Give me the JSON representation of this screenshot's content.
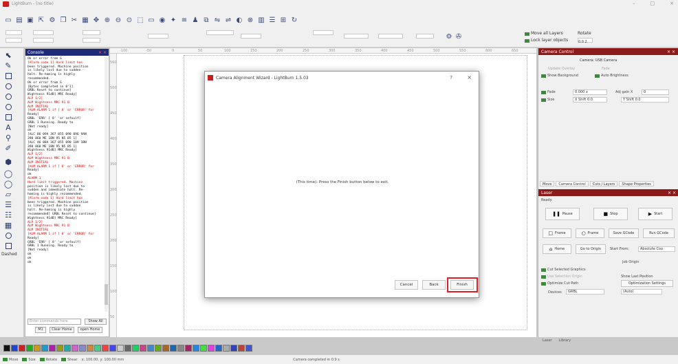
{
  "window": {
    "title": "LightBurn - (no title)"
  },
  "canvas_numbers": [
    "-100",
    "-50",
    "0",
    "50",
    "100",
    "150",
    "200",
    "250",
    "300",
    "350",
    "400",
    "450",
    "500",
    "550",
    "600",
    "650"
  ],
  "canvas_left_numbers": [
    "560",
    "500",
    "450",
    "400",
    "350",
    "300",
    "250",
    "200",
    "150",
    "100",
    "50"
  ],
  "console": {
    "title": "Console",
    "lines": [
      "Ok or error from G",
      "[Alarm code 1] Hard limit has",
      "been triggered. Machine position",
      "is likely lost due to sudden",
      "halt. Re-homing is highly",
      "recommended.",
      "Ok or error from G",
      "[Bytes completed in 0'1]",
      "GRBL Reset to continue]",
      "Wightness 91dB] MRC Ready]",
      "ALP 1/2]",
      "ALM Wightness MRC 91 B",
      "ALM INITIAL",
      "[ALM ALARM 1 if [ 8' or 'ERROR' for",
      "Ready]",
      "GRBL 'ERR' [ 8' 'or sefoulf]",
      "GRBL 1 Running. Ready to",
      "[Not ready]",
      "ok",
      "[ALC 86 09A 367 055 090 096 9AN",
      "390 860 ME 1BN 95 N5 B5 1]",
      "[ALC 46 88A 367 055 090 109 1BN",
      "390 860 ME 1BN 95 N5 B5 1]",
      "Wightness 91dB] MRC Ready]",
      "ALP 1/2]",
      "ALM Wightness MRC 91 B",
      "ALM INITIAL",
      "[ALM ALARM 1 if [ 8' or 'ERROR' for",
      "Ready]",
      "ok",
      "ALARM 1",
      "Hard limit triggered. Machine",
      "position is likely lost due to",
      "sudden and immediate halt. Re-",
      "homing is highly recommended.",
      "[Alarm code 1] Hard limit has",
      "been triggered. Machine position",
      "is likely lost due to sudden",
      "halt. Re-homing is highly",
      "recommended] GRBL Reset to continue]",
      "Wightness 91dB] MRC Ready]",
      "ALP 1/2]",
      "ALM Wightness MRC 91 B",
      "ALM INITIAL",
      "[ALM ALARM 1 if [ 8' or 'ERROR' for",
      "Ready]",
      "GRBL 'ERR' [ 8' 'or sefoulf]",
      "GRBL 1 Running. Ready to",
      "[Not ready]",
      "ok",
      "ok",
      "ok"
    ],
    "input_placeholder": "Enter commands here",
    "show_all_label": "Show All",
    "btn_macro": "M1",
    "btn_clear": "Clear Home",
    "btn_open": "open Home",
    "btn_m3": "M3",
    "btn_m4": "M4",
    "btn_m5": "M5"
  },
  "left_tools": {
    "dashed_label": "Dashed"
  },
  "dialog": {
    "title": "Camera Alignment Wizard - LightBurn 1.5.03",
    "help": "?",
    "close": "×",
    "message": "(This time): Press the Finish button below to exit.",
    "cancel_label": "Cancel",
    "back_label": "Back",
    "finish_label": "Finish"
  },
  "right_panel": {
    "camera_title": "Camera Control",
    "camera_name": "Camera: USB Camera",
    "update_overlay": "Update Overlay",
    "fade": "Fade",
    "show_background": "Show Background",
    "auto_brightness": "Auto Brightness",
    "fade_label": "Fade",
    "fade_value": "0.000 x",
    "adjust_x": "Adj gain X",
    "adjust_x_value": "0",
    "size_label": "Size",
    "size_value": "X Shift 0.0",
    "size_y_value": "Y Shift 0.0",
    "tabs": [
      "Move",
      "Camera Control",
      "Cuts / Layers",
      "Shape Properties"
    ],
    "laser_title": "Laser",
    "ready": "Ready",
    "pause_label": "Pause",
    "stop_label": "Stop",
    "start_label": "Start",
    "frame_label": "Frame",
    "frame2_label": "Frame",
    "save_gcode": "Save GCode",
    "run_gcode": "Run GCode",
    "home_label": "Home",
    "go_to_origin": "Go to Origin",
    "start_from": "Start From:",
    "start_from_value": "Absolute Coo",
    "job_origin": "Job Origin",
    "cut_selected": "Cut Selected Graphics",
    "use_selection_origin": "Use Selection Origin",
    "show_last_position": "Show Last Position",
    "optimize_cut_path": "Optimize Cut Path",
    "optimization_settings": "Optimization Settings",
    "devices_label": "Devices",
    "device_value": "GRBL",
    "port_value": "(Auto)",
    "bottom_tabs": [
      "Laser",
      "Library"
    ]
  },
  "toolbar": {
    "move_all": "Move all Layers",
    "lock": "Lock layer objects",
    "rotate_label": "Rotate",
    "rotate_value": "0.0 2"
  },
  "palette": {
    "colors": [
      "#111111",
      "#2244cc",
      "#cc2222",
      "#22aa22",
      "#cc9922",
      "#2299cc",
      "#aa22aa",
      "#999922",
      "#22aaaa",
      "#cc66cc",
      "#8888cc",
      "#cc8844",
      "#44cc88",
      "#ee4444",
      "#4444ee",
      "#cccccc",
      "#666666",
      "#22cc66",
      "#cc4488",
      "#4488cc",
      "#66aa22",
      "#aa6622",
      "#2266aa",
      "#888888",
      "#aa2266",
      "#2288dd",
      "#44dd44",
      "#dd44dd",
      "#2266cc",
      "#aaaaaa",
      "#3344bb",
      "#bb4433",
      "#4455cc"
    ]
  },
  "status": {
    "move": "Move",
    "size": "Size",
    "rotate": "Rotate",
    "shear": "Shear",
    "coords": "x: 100.00, y: 100.00 mm",
    "message": "Camera completed in 0.9 s"
  }
}
